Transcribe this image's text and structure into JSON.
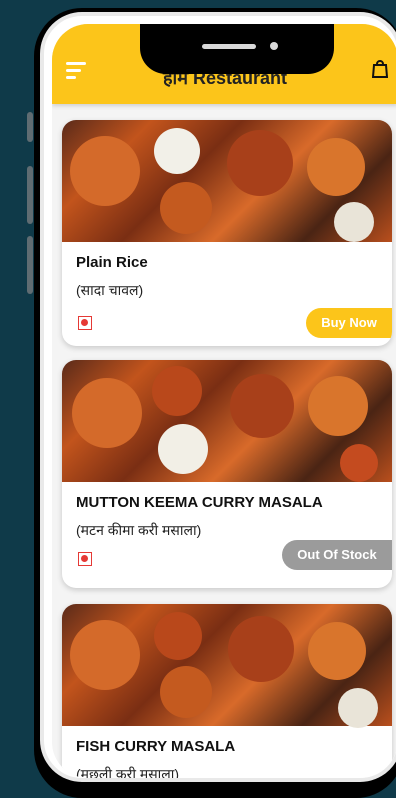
{
  "app": {
    "title": "हाम Restaurant"
  },
  "icons": {
    "menu": "menu-icon",
    "cart": "shopping-bag-icon"
  },
  "items": [
    {
      "name": "Plain Rice",
      "hindi": "(सादा चावल)",
      "button": "Buy Now",
      "status": "available"
    },
    {
      "name": "MUTTON KEEMA CURRY MASALA",
      "hindi": "(मटन कीमा करी मसाला)",
      "button": "Out Of Stock",
      "status": "out_of_stock"
    },
    {
      "name": "FISH CURRY MASALA",
      "hindi": "(मछली करी मसाला)",
      "button": "",
      "status": ""
    }
  ],
  "colors": {
    "background": "#0f3a49",
    "accent": "#fcc51a",
    "out_of_stock": "#9b9b9b",
    "nonveg_mark": "#e53935"
  }
}
